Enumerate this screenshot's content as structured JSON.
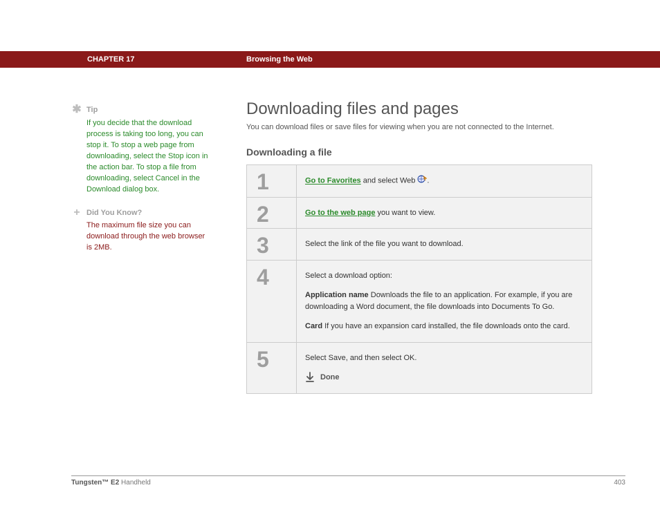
{
  "header": {
    "chapter": "CHAPTER 17",
    "title": "Browsing the Web"
  },
  "sidebar": {
    "tip": {
      "heading": "Tip",
      "body": "If you decide that the download process is taking too long, you can stop it. To stop a web page from downloading, select the Stop icon in the action bar. To stop a file from downloading, select Cancel in the Download dialog box."
    },
    "dyk": {
      "heading": "Did You Know?",
      "body": "The maximum file size you can download through the web browser is 2MB."
    }
  },
  "main": {
    "title": "Downloading files and pages",
    "intro": "You can download files or save files for viewing when you are not connected to the Internet.",
    "subheading": "Downloading a file"
  },
  "steps": {
    "n1": "1",
    "s1_link": "Go to Favorites",
    "s1_rest": " and select Web ",
    "n2": "2",
    "s2_link": "Go to the web page",
    "s2_rest": " you want to view.",
    "n3": "3",
    "s3_body": "Select the link of the file you want to download.",
    "n4": "4",
    "s4_intro": "Select a download option:",
    "s4_opt1_label": "Application name",
    "s4_opt1_body": "    Downloads the file to an application. For example, if you are downloading a Word document, the file downloads into Documents To Go.",
    "s4_opt2_label": "Card",
    "s4_opt2_body": "    If you have an expansion card installed, the file downloads onto the card.",
    "n5": "5",
    "s5_body": "Select Save, and then select OK.",
    "done": "Done"
  },
  "footer": {
    "product_bold": "Tungsten™ E2",
    "product_rest": " Handheld",
    "page": "403"
  }
}
